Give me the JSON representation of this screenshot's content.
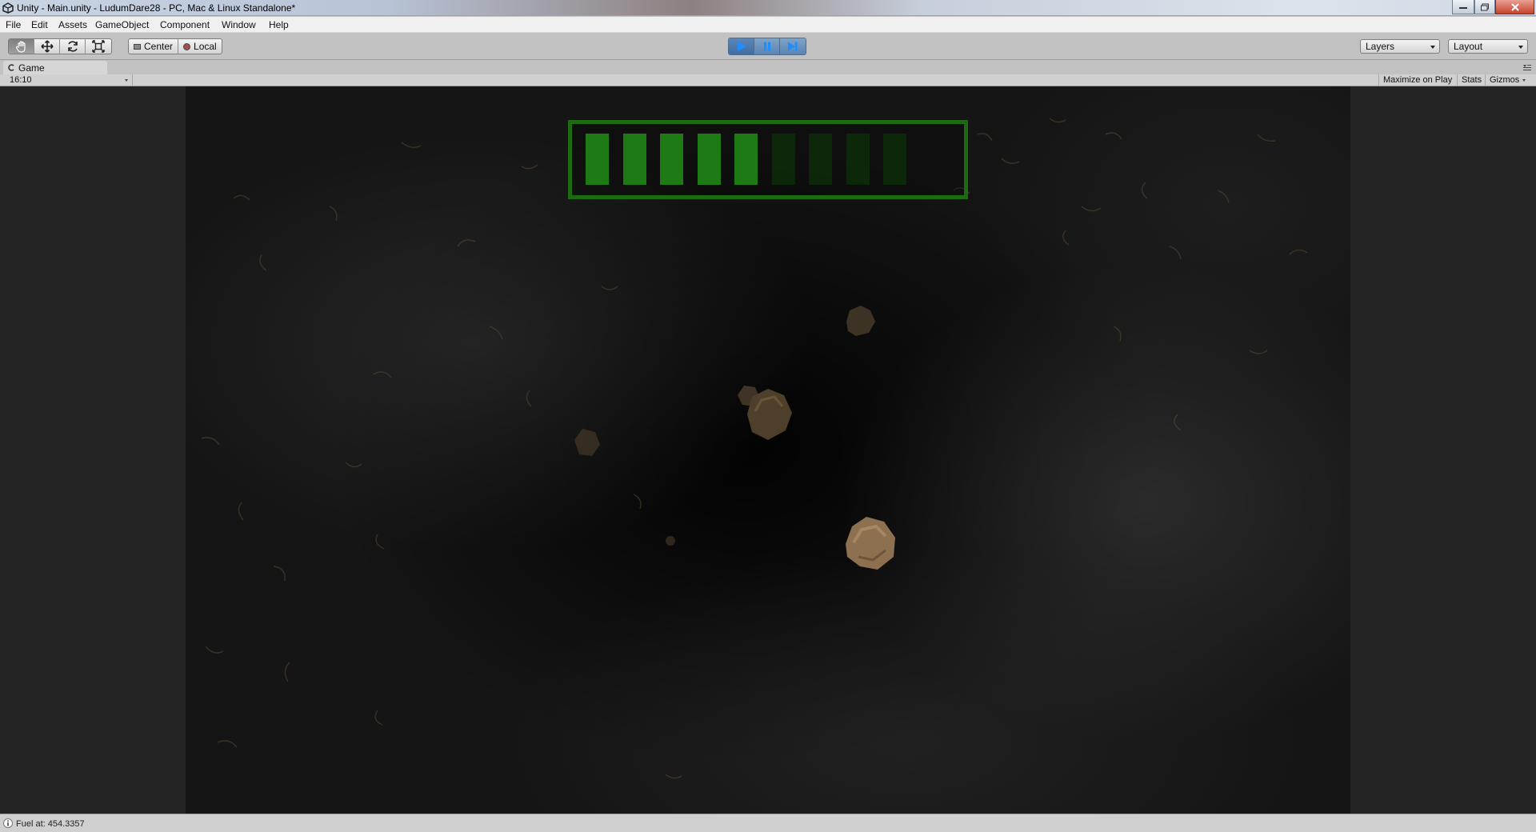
{
  "window": {
    "title": "Unity - Main.unity - LudumDare28 - PC, Mac & Linux Standalone*"
  },
  "menu": [
    "File",
    "Edit",
    "Assets",
    "GameObject",
    "Component",
    "Window",
    "Help"
  ],
  "toolbar": {
    "tools": [
      "hand-icon",
      "move-icon",
      "rotate-icon",
      "scale-icon"
    ],
    "pivot_mode_label": "Center",
    "pivot_rotation_label": "Local",
    "layers_label": "Layers",
    "layout_label": "Layout",
    "playing": true
  },
  "game_view": {
    "tab_label": "Game",
    "aspect_label": "16:10",
    "maximize_label": "Maximize on Play",
    "stats_label": "Stats",
    "gizmos_label": "Gizmos"
  },
  "hud": {
    "fuel_cells_total": 9,
    "fuel_cells_filled": 5,
    "fuel_color": "#1d7a14"
  },
  "status": {
    "message": "Fuel at: 454.3357"
  }
}
